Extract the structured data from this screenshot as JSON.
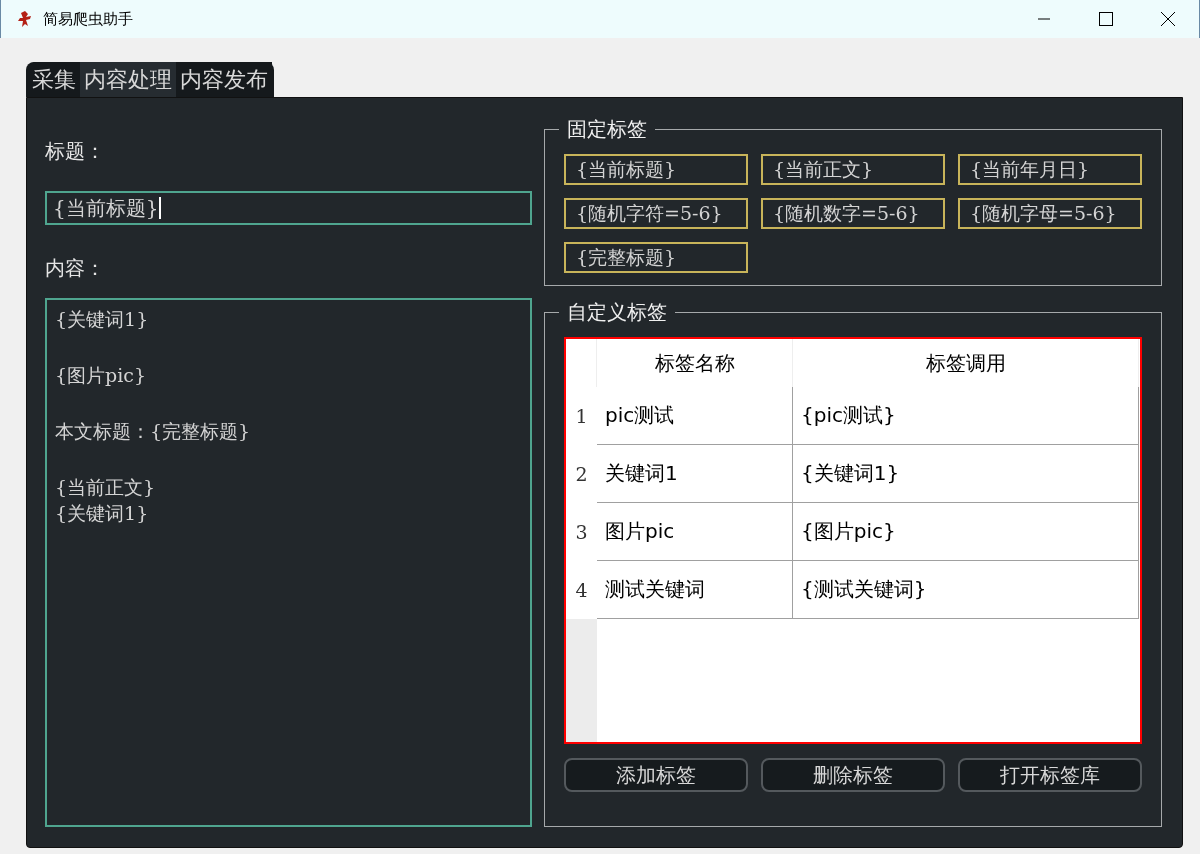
{
  "window": {
    "title": "简易爬虫助手"
  },
  "tabs": [
    {
      "label": "采集",
      "selected": false
    },
    {
      "label": "内容处理",
      "selected": true
    },
    {
      "label": "内容发布",
      "selected": false
    }
  ],
  "title_field": {
    "label": "标题：",
    "value": "{当前标题}",
    "focused": true
  },
  "content_field": {
    "label": "内容：",
    "paragraphs": [
      [
        "{关键词1}"
      ],
      [
        "{图片pic}"
      ],
      [
        "本文标题：{完整标题}"
      ],
      [
        "{当前正文}",
        "{关键词1}"
      ]
    ]
  },
  "fixed_tags": {
    "title": "固定标签",
    "tags": [
      "{当前标题}",
      "{当前正文}",
      "{当前年月日}",
      "{随机字符=5-6}",
      "{随机数字=5-6}",
      "{随机字母=5-6}",
      "{完整标题}"
    ]
  },
  "custom_tags": {
    "title": "自定义标签",
    "table": {
      "columns": [
        "标签名称",
        "标签调用"
      ],
      "rows": [
        {
          "number": "1",
          "cells": [
            "pic测试",
            "{pic测试}"
          ]
        },
        {
          "number": "2",
          "cells": [
            "关键词1",
            "{关键词1}"
          ]
        },
        {
          "number": "3",
          "cells": [
            "图片pic",
            "{图片pic}"
          ]
        },
        {
          "number": "4",
          "cells": [
            "测试关键词",
            "{测试关键词}"
          ]
        }
      ]
    },
    "buttons": [
      "添加标签",
      "删除标签",
      "打开标签库"
    ]
  }
}
